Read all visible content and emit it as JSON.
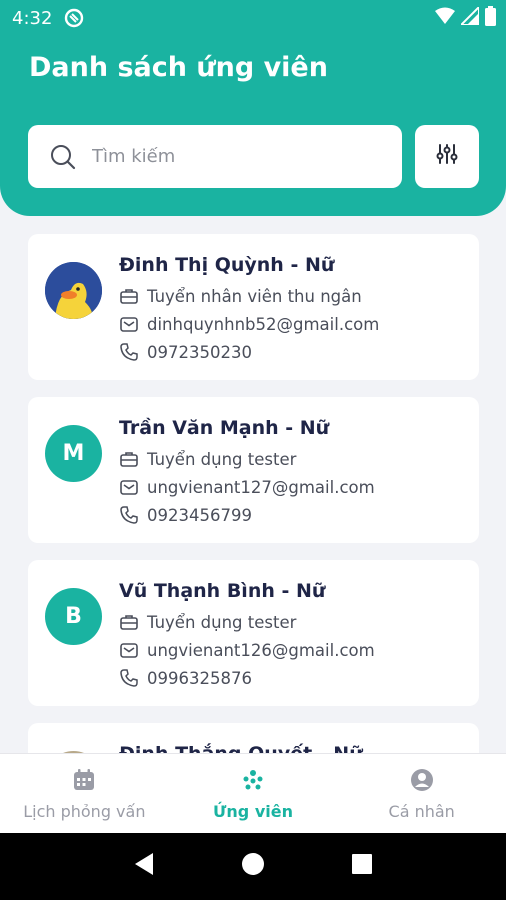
{
  "status_bar": {
    "time": "4:32"
  },
  "header": {
    "title": "Danh sách ứng viên"
  },
  "search": {
    "placeholder": "Tìm kiếm",
    "value": ""
  },
  "candidates": [
    {
      "name": "Đinh Thị Quỳnh - Nữ",
      "avatar": "photo",
      "job": "Tuyển nhân viên thu ngân",
      "email": "dinhquynhnb52@gmail.com",
      "phone": "0972350230"
    },
    {
      "name": "Trần Văn Mạnh - Nữ",
      "avatar": "M",
      "job": "Tuyển dụng tester",
      "email": "ungvienant127@gmail.com",
      "phone": "0923456799"
    },
    {
      "name": "Vũ Thạnh Bình - Nữ",
      "avatar": "B",
      "job": "Tuyển dụng tester",
      "email": "ungvienant126@gmail.com",
      "phone": "0996325876"
    },
    {
      "name": "Đinh Thắng Quyết - Nữ",
      "avatar": "photo"
    }
  ],
  "bottom_nav": [
    {
      "label": "Lịch phỏng vấn",
      "icon": "calendar-icon",
      "active": false
    },
    {
      "label": "Ứng viên",
      "icon": "people-icon",
      "active": true
    },
    {
      "label": "Cá nhân",
      "icon": "profile-icon",
      "active": false
    }
  ],
  "colors": {
    "accent": "#1ab3a1",
    "background": "#f2f3f7",
    "name_text": "#1f2547"
  }
}
